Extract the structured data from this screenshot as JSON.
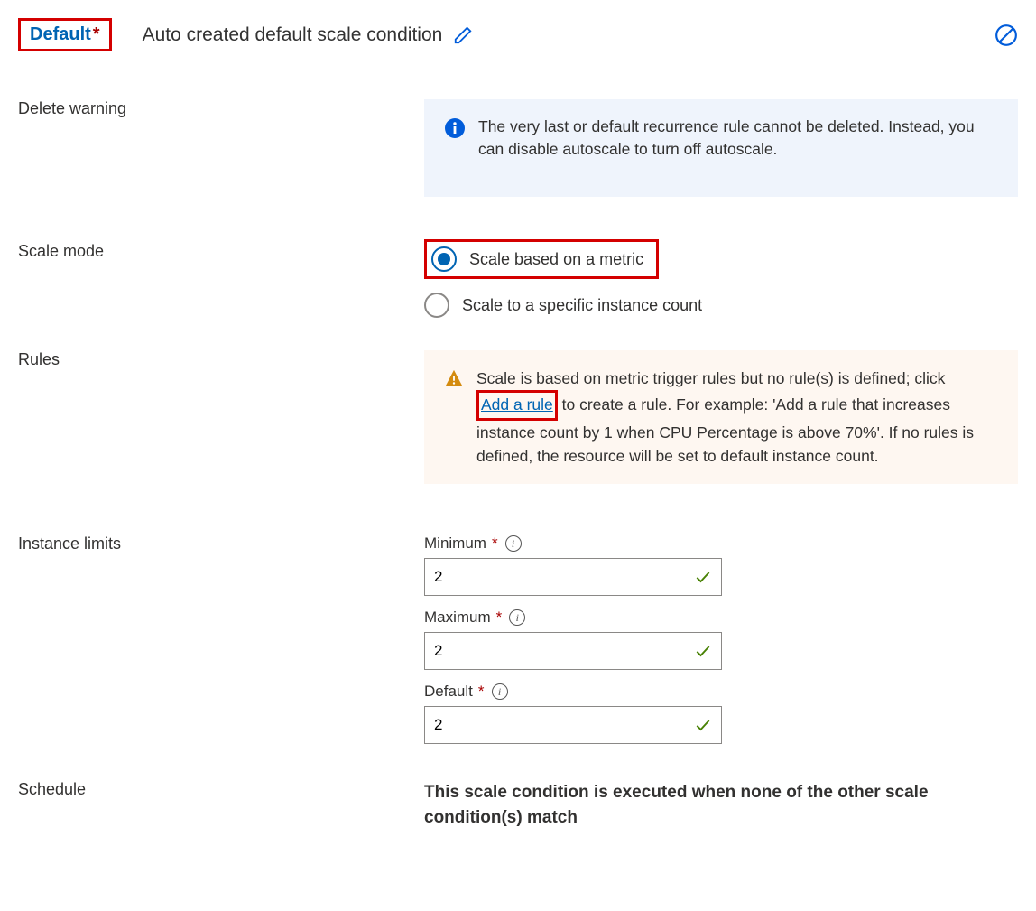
{
  "header": {
    "chip": "Default",
    "title": "Auto created default scale condition"
  },
  "sections": {
    "deleteWarning": {
      "label": "Delete warning",
      "message": "The very last or default recurrence rule cannot be deleted. Instead, you can disable autoscale to turn off autoscale."
    },
    "scaleMode": {
      "label": "Scale mode",
      "optionMetric": "Scale based on a metric",
      "optionInstance": "Scale to a specific instance count"
    },
    "rules": {
      "label": "Rules",
      "textBefore": "Scale is based on metric trigger rules but no rule(s) is defined; click ",
      "link": "Add a rule",
      "textAfter": " to create a rule. For example: 'Add a rule that increases instance count by 1 when CPU Percentage is above 70%'. If no rules is defined, the resource will be set to default instance count."
    },
    "instanceLimits": {
      "label": "Instance limits",
      "minimum": {
        "label": "Minimum",
        "value": "2"
      },
      "maximum": {
        "label": "Maximum",
        "value": "2"
      },
      "default": {
        "label": "Default",
        "value": "2"
      }
    },
    "schedule": {
      "label": "Schedule",
      "text": "This scale condition is executed when none of the other scale condition(s) match"
    }
  }
}
